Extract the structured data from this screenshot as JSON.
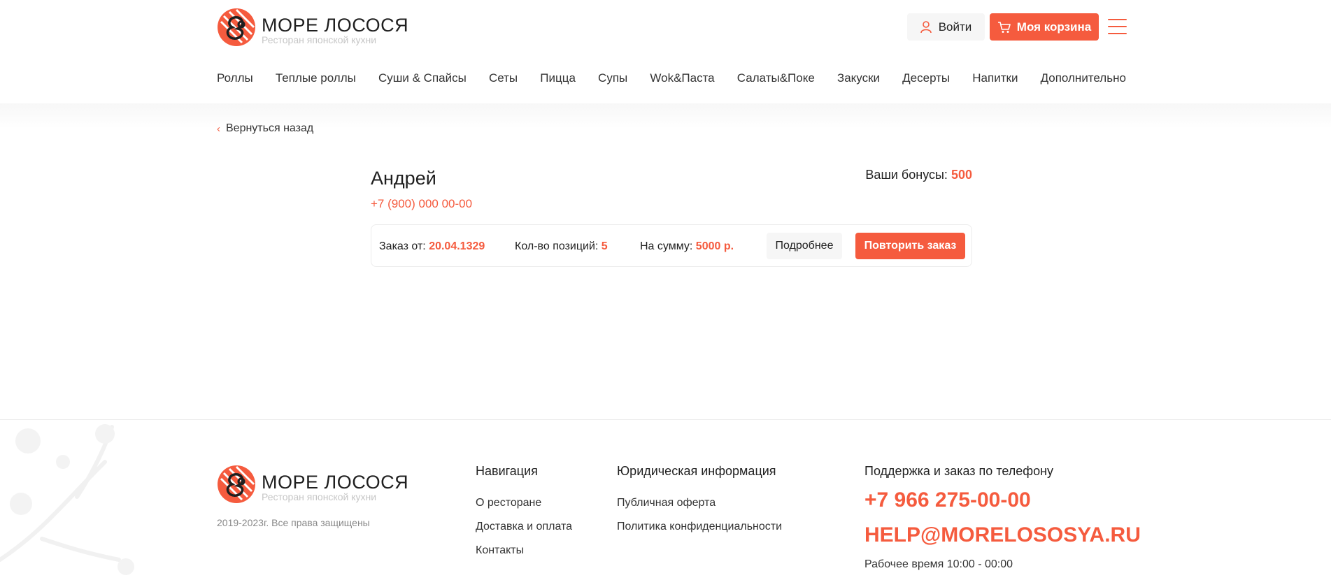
{
  "brand": {
    "name": "МОРЕ ЛОСОСЯ",
    "tagline": "Ресторан японской кухни",
    "accent_color": "#f55b3e",
    "logo_icon": "salmon-roll-logo"
  },
  "header": {
    "login_label": "Войти",
    "cart_label": "Моя корзина",
    "menu_icon": "hamburger-icon"
  },
  "nav": {
    "items": [
      "Роллы",
      "Теплые роллы",
      "Суши & Спайсы",
      "Сеты",
      "Пицца",
      "Супы",
      "Wok&Паста",
      "Салаты&Поке",
      "Закуски",
      "Десерты",
      "Напитки",
      "Дополнительно"
    ]
  },
  "main": {
    "back_label": "Вернуться назад",
    "user": {
      "name": "Андрей",
      "phone": "+7 (900) 000 00-00"
    },
    "bonus": {
      "label": "Ваши бонусы:",
      "value": "500"
    },
    "order": {
      "date_label": "Заказ от:",
      "date_value": "20.04.1329",
      "count_label": "Кол-во позиций:",
      "count_value": "5",
      "sum_label": "На сумму:",
      "sum_value": "5000 р.",
      "details_label": "Подробнее",
      "repeat_label": "Повторить заказ"
    }
  },
  "footer": {
    "copyright": "2019-2023г. Все права защищены",
    "navigation": {
      "title": "Навигация",
      "links": [
        "О ресторане",
        "Доставка и оплата",
        "Контакты"
      ]
    },
    "legal": {
      "title": "Юридическая информация",
      "links": [
        "Публичная оферта",
        "Политика конфиденциальности"
      ]
    },
    "contact": {
      "title": "Поддержка и заказ по телефону",
      "phone": "+7 966 275-00-00",
      "email": "HELP@MORELOSOSYA.RU",
      "hours": "Рабочее время 10:00 - 00:00"
    }
  }
}
